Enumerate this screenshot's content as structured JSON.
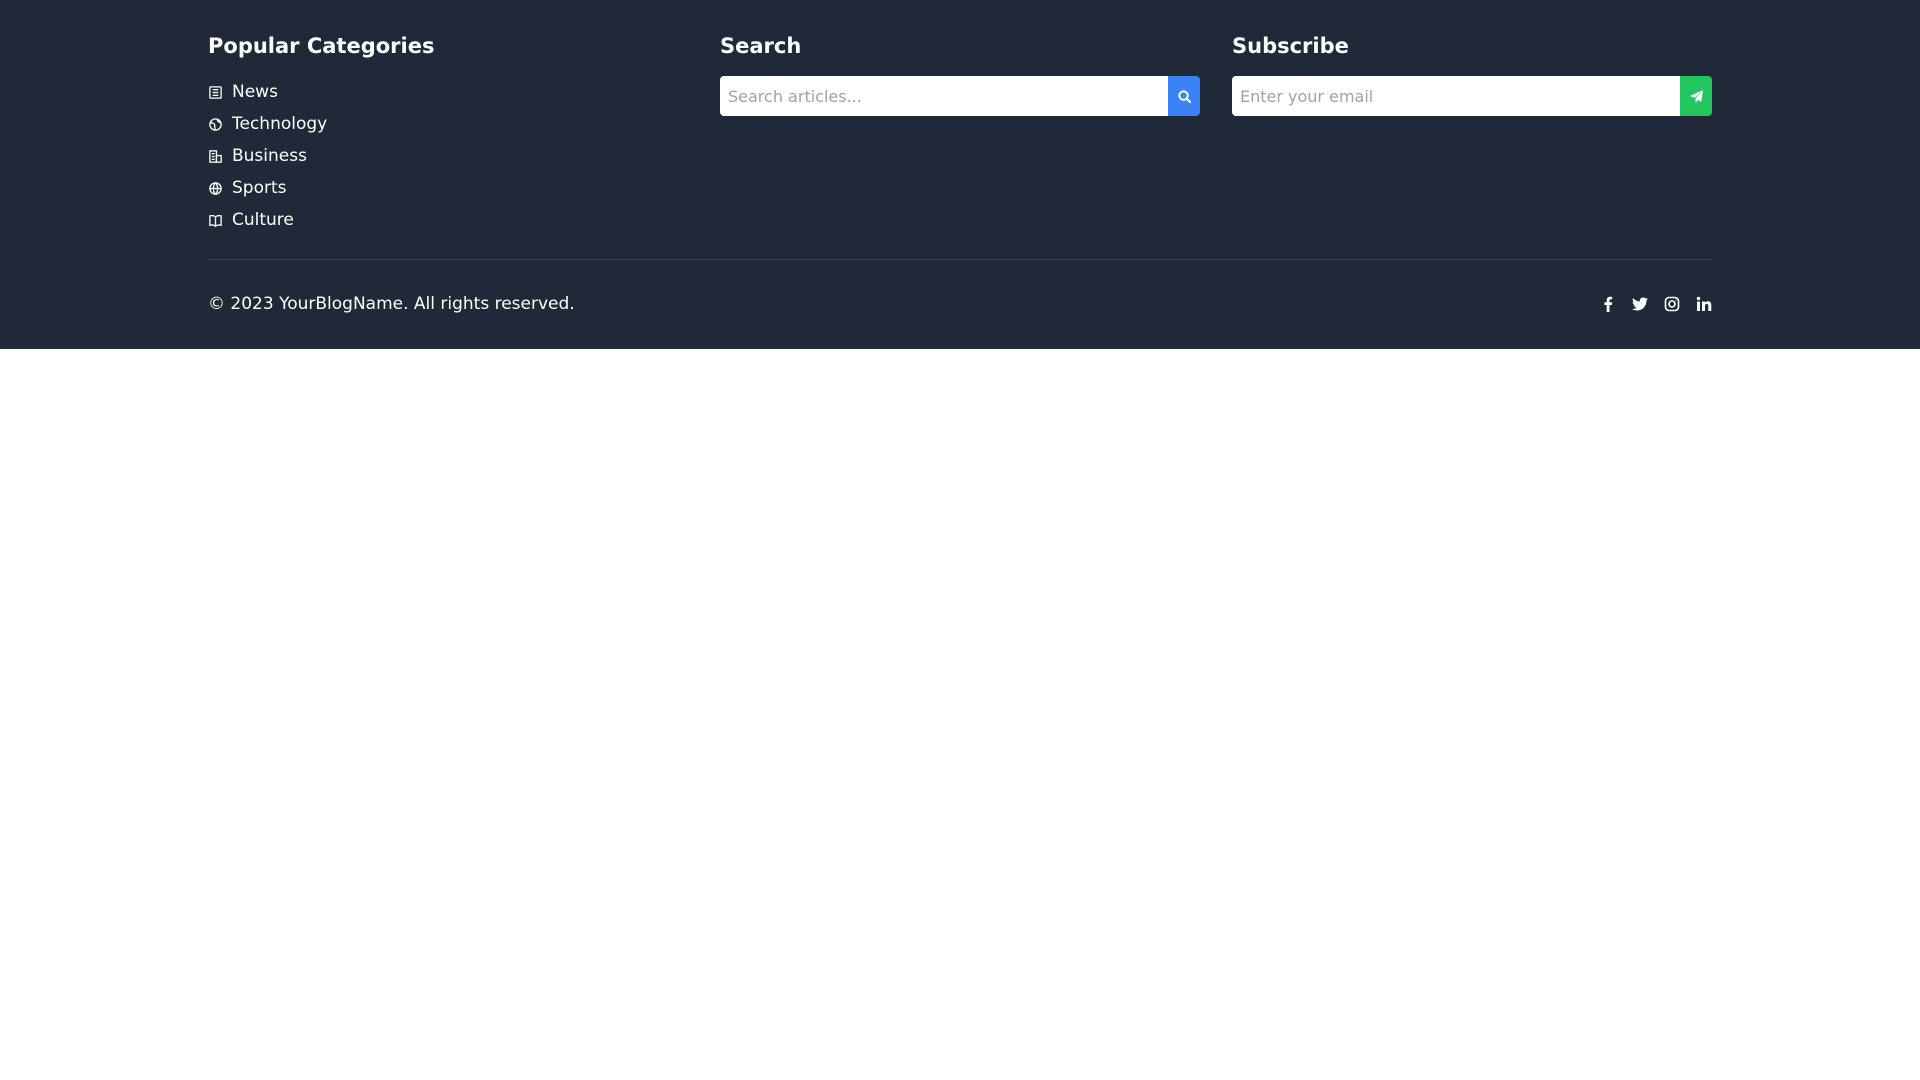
{
  "categories": {
    "title": "Popular Categories",
    "items": [
      {
        "label": "News",
        "icon": "newspaper-icon"
      },
      {
        "label": "Technology",
        "icon": "globe-icon"
      },
      {
        "label": "Business",
        "icon": "building-icon"
      },
      {
        "label": "Sports",
        "icon": "ball-icon"
      },
      {
        "label": "Culture",
        "icon": "book-icon"
      }
    ]
  },
  "search": {
    "title": "Search",
    "placeholder": "Search articles...",
    "button_icon": "search-icon",
    "button_color": "#3b82f6"
  },
  "subscribe": {
    "title": "Subscribe",
    "placeholder": "Enter your email",
    "button_icon": "paper-plane-icon",
    "button_color": "#22c55e"
  },
  "footer": {
    "copyright": "© 2023 YourBlogName. All rights reserved.",
    "socials": [
      "facebook-icon",
      "twitter-icon",
      "instagram-icon",
      "linkedin-icon"
    ]
  },
  "colors": {
    "background": "#1f2937",
    "divider": "#374151",
    "page": "#ffffff"
  }
}
